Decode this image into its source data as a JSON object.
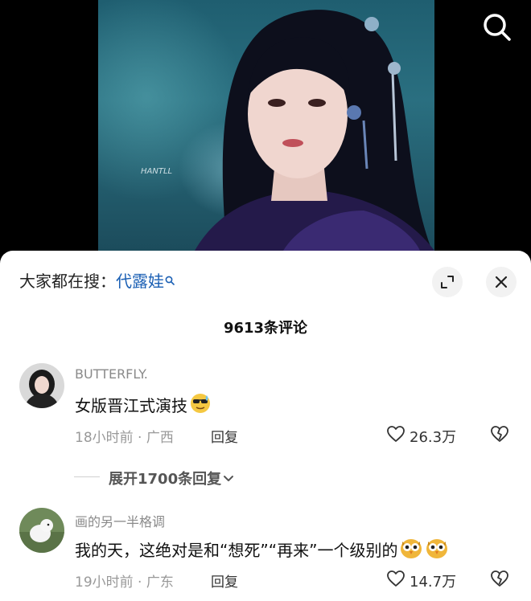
{
  "video": {
    "watermark": "HANTLL"
  },
  "icons": {
    "search": "search-icon",
    "expand": "expand-icon",
    "close": "close-icon",
    "like": "heart-icon",
    "dislike": "broken-heart-icon",
    "chevron": "chevron-down-icon"
  },
  "search_hint": {
    "prefix": "大家都在搜：",
    "keyword": "代露娃"
  },
  "comments_header": {
    "count_title": "9613条评论"
  },
  "comments": [
    {
      "username": "BUTTERFLY.",
      "text": "女版晋江式演技",
      "emoji": "smiling-face-with-sunglasses-sweat",
      "meta": "18小时前 · 广西",
      "reply_label": "回复",
      "likes": "26.3万"
    },
    {
      "username": "画的另一半格调",
      "text": "我的天，这绝对是和“想死”“再来”一个级别的",
      "emoji": "owl-face",
      "meta": "19小时前 · 广东",
      "reply_label": "回复",
      "likes": "14.7万"
    }
  ],
  "expand_replies": {
    "label": "展开1700条回复"
  },
  "colors": {
    "keyword_link": "#1a5fb4",
    "sheet_bg": "#ffffff",
    "meta_text": "#999999"
  }
}
